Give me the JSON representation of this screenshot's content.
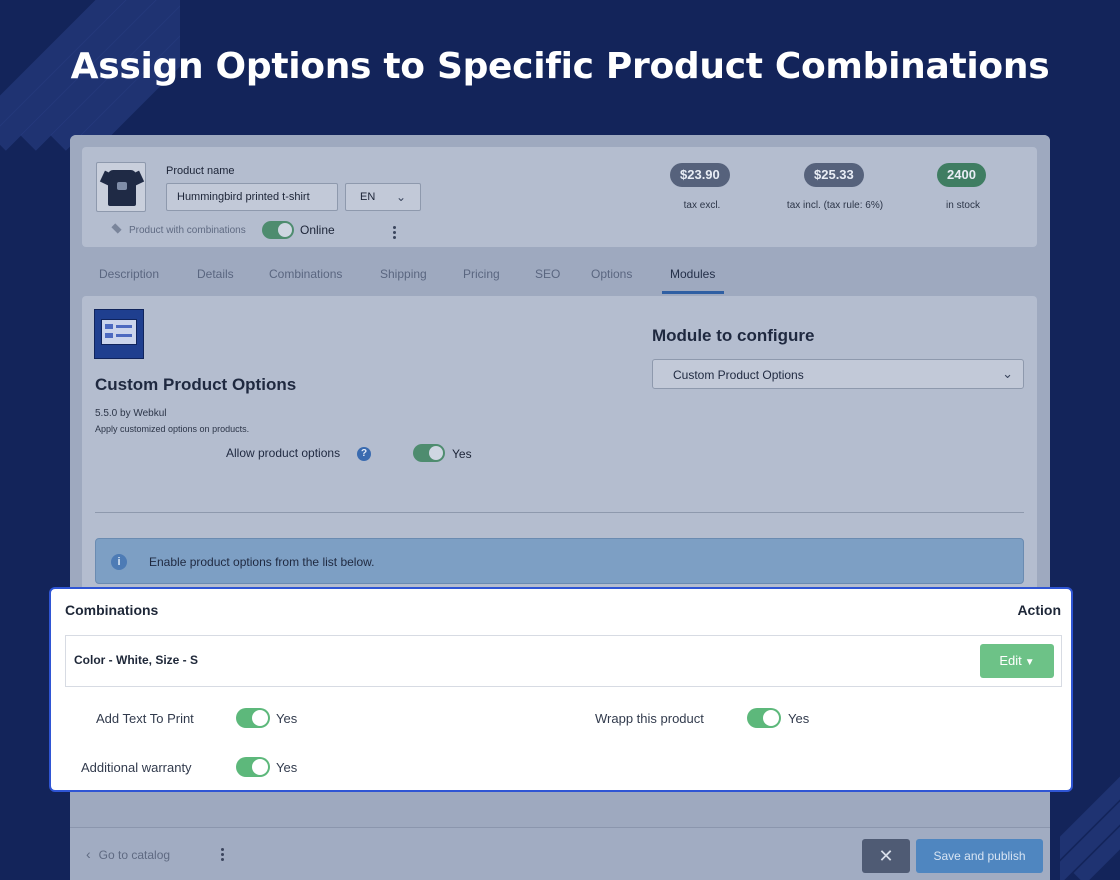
{
  "headline": "Assign Options to Specific Product Combinations",
  "product": {
    "name_label": "Product name",
    "name_value": "Hummingbird printed t-shirt",
    "language": "EN",
    "combinations_label": "Product with combinations",
    "status_label": "Online"
  },
  "prices": [
    {
      "value": "$23.90",
      "caption": "tax excl."
    },
    {
      "value": "$25.33",
      "caption": "tax incl. (tax rule: 6%)"
    },
    {
      "value": "2400",
      "caption": "in stock"
    }
  ],
  "tabs": [
    "Description",
    "Details",
    "Combinations",
    "Shipping",
    "Pricing",
    "SEO",
    "Options",
    "Modules"
  ],
  "active_tab": "Modules",
  "module": {
    "title": "Custom Product Options",
    "version": "5.5.0 by Webkul",
    "description": "Apply customized options on products.",
    "allow_label": "Allow product options",
    "allow_value": "Yes",
    "configure_label": "Module to configure",
    "configure_value": "Custom Product Options",
    "info_text": "Enable product options from the list below."
  },
  "panel": {
    "col_combinations": "Combinations",
    "col_action": "Action",
    "combination": "Color - White, Size - S",
    "edit_label": "Edit",
    "options": [
      {
        "label": "Add Text To Print",
        "value": "Yes"
      },
      {
        "label": "Wrapp this product",
        "value": "Yes"
      },
      {
        "label": "Additional warranty",
        "value": "Yes"
      }
    ]
  },
  "footer": {
    "back_label": "Go to catalog",
    "save_label": "Save and publish"
  },
  "colors": {
    "background": "#13245a",
    "accent_border": "#2f55d4",
    "toggle_on": "#5db87b",
    "edit_button": "#6dc287"
  }
}
